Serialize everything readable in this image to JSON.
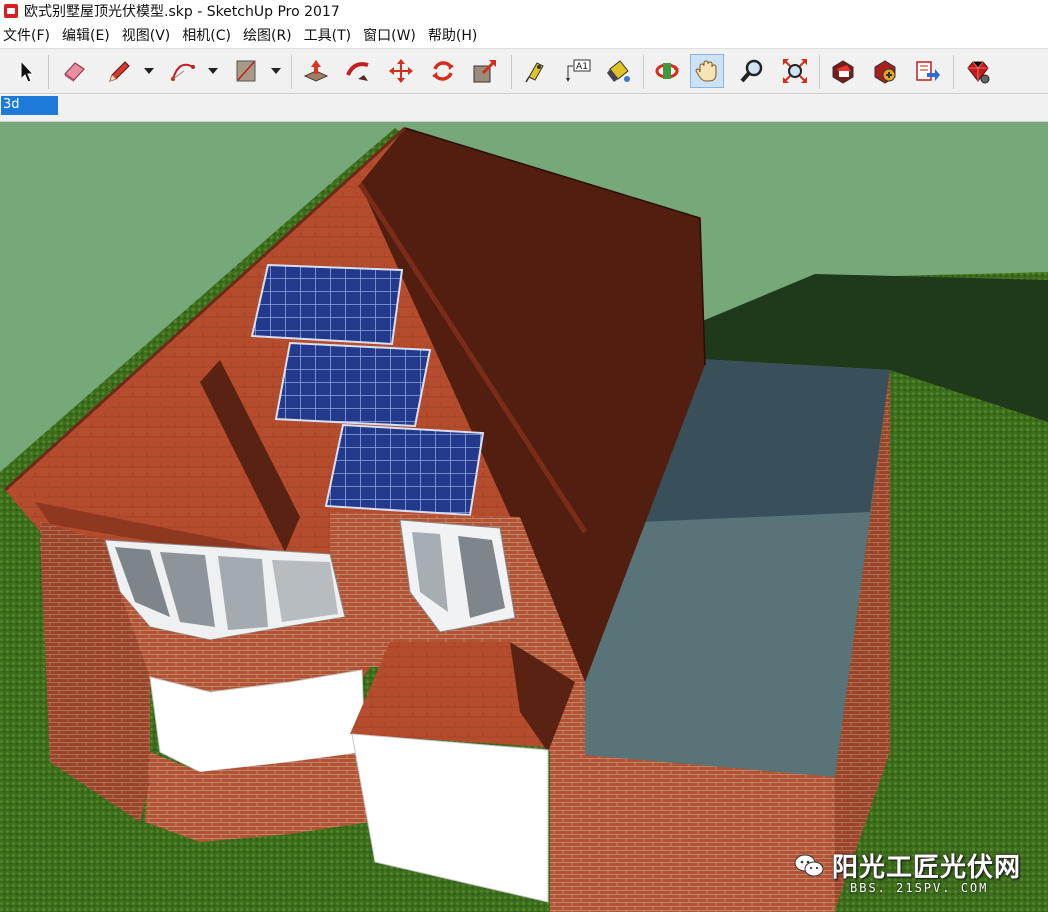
{
  "window": {
    "title": "欧式别墅屋顶光伏模型.skp - SketchUp Pro 2017"
  },
  "menu": [
    {
      "label": "文件(F)"
    },
    {
      "label": "编辑(E)"
    },
    {
      "label": "视图(V)"
    },
    {
      "label": "相机(C)"
    },
    {
      "label": "绘图(R)"
    },
    {
      "label": "工具(T)"
    },
    {
      "label": "窗口(W)"
    },
    {
      "label": "帮助(H)"
    }
  ],
  "toolbar": {
    "tools": [
      "select-icon",
      "eraser-icon",
      "pencil-icon",
      "arc-icon",
      "rectangle-icon",
      "push-pull-icon",
      "follow-me-icon",
      "move-icon",
      "rotate-icon",
      "scale-icon",
      "tape-measure-icon",
      "text-icon",
      "paint-bucket-icon",
      "orbit-icon",
      "pan-icon",
      "zoom-icon",
      "zoom-extents-icon",
      "3d-warehouse-icon",
      "extension-warehouse-icon",
      "send-to-layout-icon",
      "ruby-extension-icon"
    ],
    "active_tool": "pan-icon",
    "text_tool_label": "A1"
  },
  "layer": {
    "current": "3d"
  },
  "watermark": {
    "name": "阳光工匠光伏网",
    "url": "BBS. 21SPV. COM"
  },
  "colors": {
    "selection": "#1e7ad9",
    "sky": "#76a87a",
    "brick": "#b25434",
    "roof_dark": "#521e10",
    "flat_roof": "#5a7478"
  }
}
